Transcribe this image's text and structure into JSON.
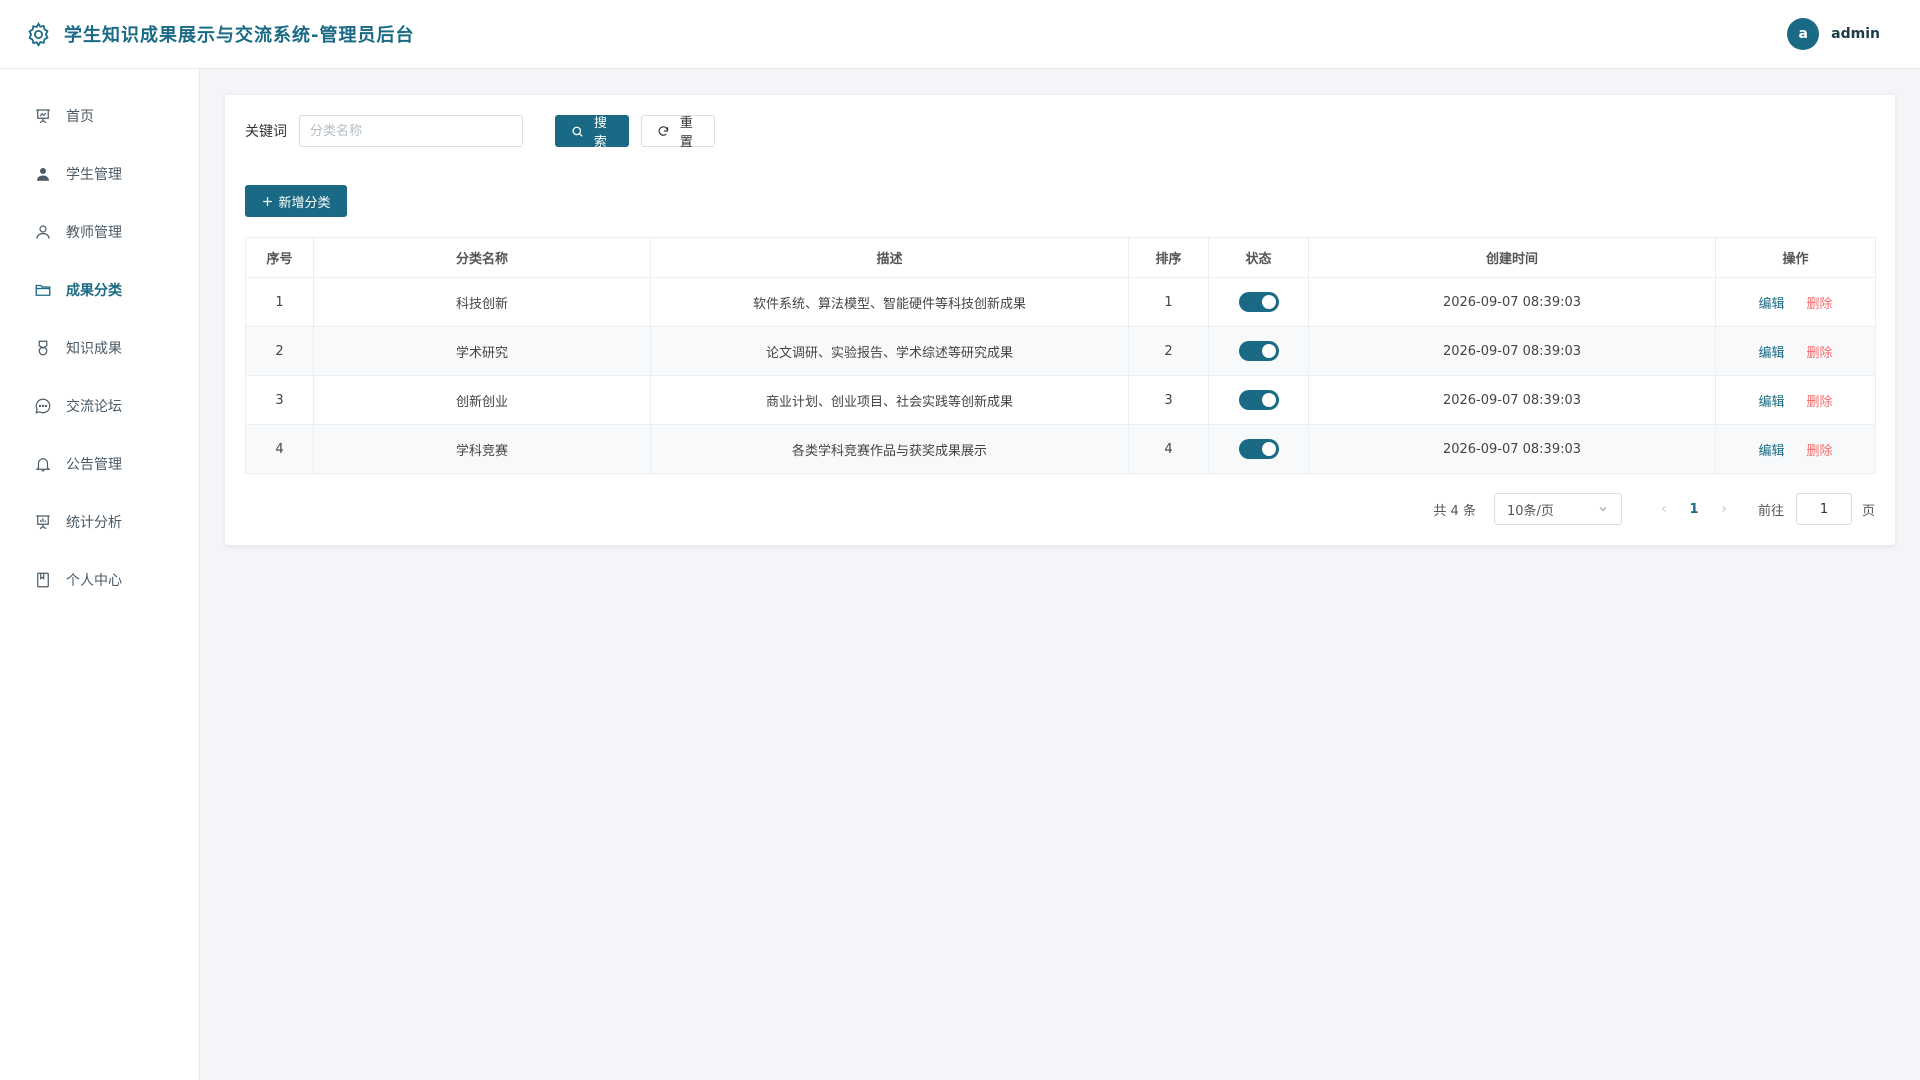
{
  "header": {
    "title": "学生知识成果展示与交流系统-管理员后台",
    "avatar_letter": "a",
    "username": "admin"
  },
  "sidebar": {
    "items": [
      {
        "label": "首页",
        "icon": "presentation-icon"
      },
      {
        "label": "学生管理",
        "icon": "user-filled-icon"
      },
      {
        "label": "教师管理",
        "icon": "user-icon"
      },
      {
        "label": "成果分类",
        "icon": "folder-icon",
        "active": true
      },
      {
        "label": "知识成果",
        "icon": "medal-icon"
      },
      {
        "label": "交流论坛",
        "icon": "chat-icon"
      },
      {
        "label": "公告管理",
        "icon": "bell-icon"
      },
      {
        "label": "统计分析",
        "icon": "chart-board-icon"
      },
      {
        "label": "个人中心",
        "icon": "notebook-icon"
      }
    ]
  },
  "search": {
    "label": "关键词",
    "placeholder": "分类名称",
    "search_label": "搜索",
    "reset_label": "重置"
  },
  "toolbar": {
    "add_label": "新增分类"
  },
  "table": {
    "headers": [
      "序号",
      "分类名称",
      "描述",
      "排序",
      "状态",
      "创建时间",
      "操作"
    ],
    "rows": [
      {
        "index": "1",
        "name": "科技创新",
        "desc": "软件系统、算法模型、智能硬件等科技创新成果",
        "sort": "1",
        "enabled": true,
        "created": "2026-09-07 08:39:03"
      },
      {
        "index": "2",
        "name": "学术研究",
        "desc": "论文调研、实验报告、学术综述等研究成果",
        "sort": "2",
        "enabled": true,
        "created": "2026-09-07 08:39:03"
      },
      {
        "index": "3",
        "name": "创新创业",
        "desc": "商业计划、创业项目、社会实践等创新成果",
        "sort": "3",
        "enabled": true,
        "created": "2026-09-07 08:39:03"
      },
      {
        "index": "4",
        "name": "学科竞赛",
        "desc": "各类学科竞赛作品与获奖成果展示",
        "sort": "4",
        "enabled": true,
        "created": "2026-09-07 08:39:03"
      }
    ],
    "edit_label": "编辑",
    "delete_label": "删除"
  },
  "pagination": {
    "total": "共 4 条",
    "page_size": "10条/页",
    "current_page": "1",
    "goto_label": "前往",
    "goto_value": "1",
    "page_unit": "页"
  },
  "colors": {
    "primary": "#1a6a85",
    "danger": "#f56c6c"
  }
}
